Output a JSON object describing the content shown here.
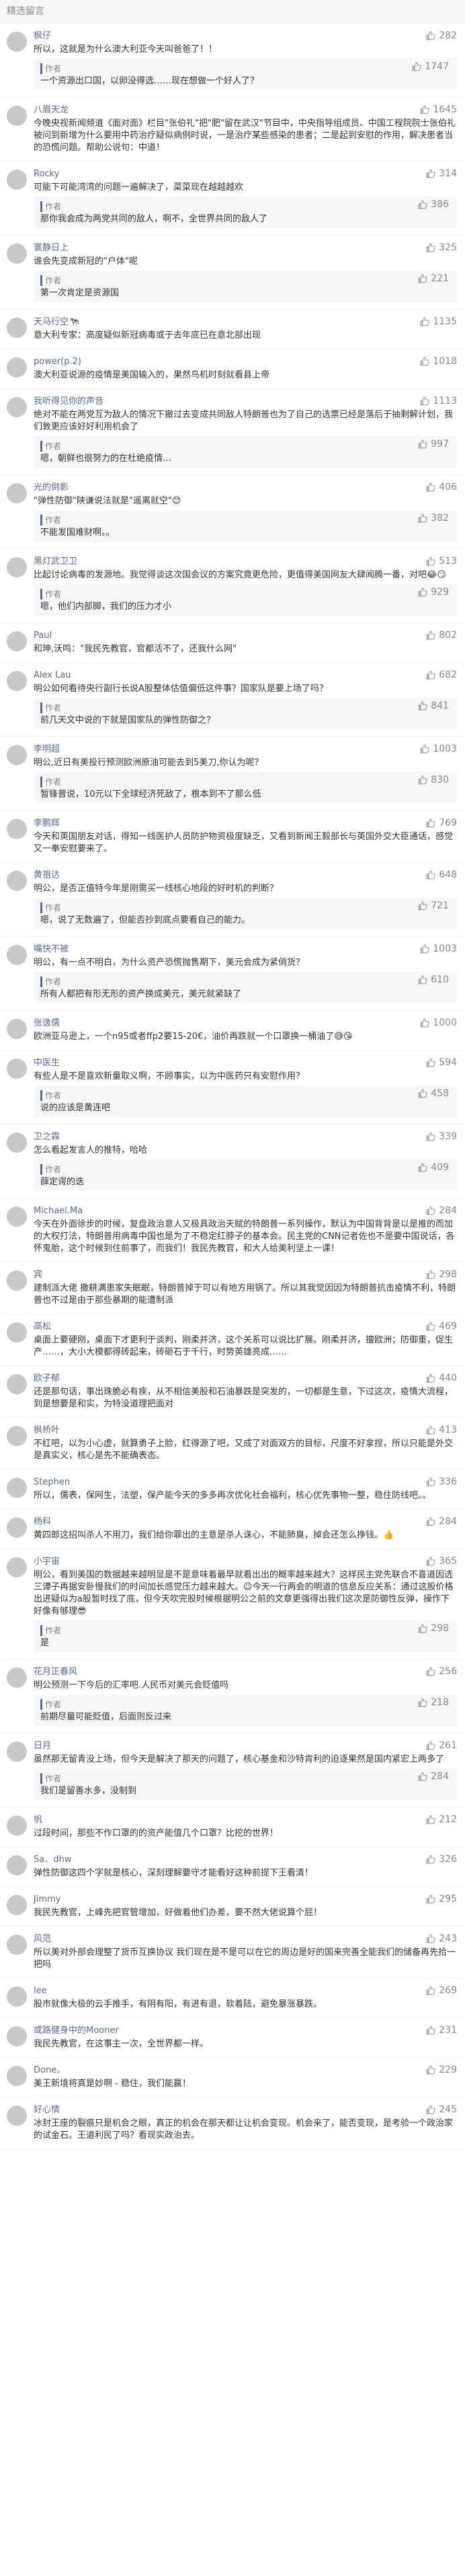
{
  "section_title": "精选留言",
  "author_label": "作者",
  "comments": [
    {
      "nick": "枫仔",
      "likes": "282",
      "text": "所以，这就是为什么澳大利亚今天叫爸爸了！！",
      "reply": {
        "likes": "1747",
        "text": "一个资源出口国，以卵没得选……现在想做一个好人了？"
      }
    },
    {
      "nick": "八眉天龙",
      "likes": "1645",
      "text": "今晚央视新闻频道《面对面》栏目\"张伯礼\"把\"肥\"留在武汉\"节目中，中央指导组成员、中国工程院院士张伯礼被问到新增为什么要用中药治疗疑似病例时说，一是治疗某些感染的患者；二是起到安慰的作用，解决患者当的恐慌问题。帮助公说句：中道！",
      "reply": null
    },
    {
      "nick": "Rocky",
      "likes": "314",
      "text": "可能下可能湾湾的问题一遍解决了，菜菜现在越越越欢",
      "reply": {
        "likes": "386",
        "text": "那你我会成为两党共同的敌人，啊不，全世界共同的敌人了"
      }
    },
    {
      "nick": "寰静日上",
      "likes": "325",
      "text": "谁会先变成新冠的\"户体\"呢",
      "reply": {
        "likes": "221",
        "text": "第一次肯定是资源国"
      }
    },
    {
      "nick": "天马行空🐄",
      "likes": "1135",
      "text": "意大利专家：高度疑似新冠病毒或于去年底已在意北部出现",
      "reply": null
    },
    {
      "nick": "power(p.2)",
      "likes": "1018",
      "text": "澳大利亚说源的疫情是美国输入的，果然鸟机时刻就看县上帝",
      "reply": null
    },
    {
      "nick": "我听得见你的声音",
      "likes": "1113",
      "text": "绝对不能在两党互为敌人的情况下撤过去变成共同敌人特朗普也为了自己的选票已经是落后于抽剩解计划，我们敦更应该好好利用机会了",
      "reply": {
        "likes": "997",
        "text": "嗯，朝鲜也很努力的在杜绝疫情…"
      }
    },
    {
      "nick": "光的倒影",
      "likes": "406",
      "text": "\"弹性防御\"陕谦说法就是\"遥离就空\"😊",
      "reply": {
        "likes": "382",
        "text": "不能发国难财啊。。"
      }
    },
    {
      "nick": "黑灯武卫卫",
      "likes": "513",
      "text": "比起讨论病毒的发源地。我觉得谈这次国会议的方案究竟更危险，更值得美国网友大肆闻腾一番，对吧😂😏",
      "reply": {
        "likes": "929",
        "text": "嗯，他们内部脚，我们的压力才小"
      }
    },
    {
      "nick": "Paul",
      "likes": "802",
      "text": "和珅,沃鸣：\"我民先教官，官都活不了，还我什么网\"",
      "reply": null
    },
    {
      "nick": "Alex Lau",
      "likes": "682",
      "text": "明公如何看待央行副行长说A股整体估值偏低这件事？国家队是要上场了吗？",
      "reply": {
        "likes": "841",
        "text": "前几天文中说的下就是国家队的弹性防御之？"
      }
    },
    {
      "nick": "李明超",
      "likes": "1003",
      "text": "明公,近日有美投行预测欧洲原油可能去到5美刀,你认为呢？",
      "reply": {
        "likes": "830",
        "text": "暂锋普说，10元以下全球经济死敌了，根本到不了那么低"
      }
    },
    {
      "nick": "李鹏辉",
      "likes": "769",
      "text": "今天和英国朋友对话，得知一线医护人员防护物资极度缺乏，又看到新闻王毅部长与英国外交大臣通话，感觉又一拳安慰要来了。",
      "reply": null
    },
    {
      "nick": "黄祖达",
      "likes": "648",
      "text": "明公，是否正值特今年是刚需买一线核心地段的好时机的判断？",
      "reply": {
        "likes": "721",
        "text": "嗯，说了无数遍了，但能否抄到底点要看自己的能力。"
      }
    },
    {
      "nick": "嘴快不被",
      "likes": "1003",
      "text": "明公，有一点不明白，为什么资产恐慌抛售期下，美元会成为紧俏货？",
      "reply": {
        "likes": "610",
        "text": "所有人都把有形无形的资产换成美元，美元就紧缺了"
      }
    },
    {
      "nick": "张逸儒",
      "likes": "1000",
      "text": "欧洲亚马逊上，一个n95或者ffp2要15-20€，油价再跌就一个口罩换一桶油了😅😘",
      "reply": null
    },
    {
      "nick": "中医生",
      "likes": "594",
      "text": "有些人是不是喜欢新量取义啊，不顾事实，以为中医药只有安慰作用？",
      "reply": {
        "likes": "458",
        "text": "说的应该是黄连吧"
      }
    },
    {
      "nick": "卫之霖",
      "likes": "339",
      "text": "怎么看起发言人的推特，哈哈",
      "reply": {
        "likes": "409",
        "text": "薛定谔的迭"
      }
    },
    {
      "nick": "Michael.Ma",
      "likes": "284",
      "text": "今天在外面徐步的时候，复盘政治意人又极具政治天赋的特朗普一系列操作，默认为中国背背是以是推的而加的大权打法，特朗普用病毒中国也是为了不稳定红脖子的基本会。民主党的CNN记者佐也不是要中国说话，各怀鬼胎，这个时候到住前事了，而我们！我民先教官，和大人给美利坚上一课！",
      "reply": null
    },
    {
      "nick": "宾",
      "likes": "298",
      "text": "建制派大佬 撒耕满患家失眠眠，特朗普掉于可以有地方用锅了。所以其我觉因因为特朗普抗击疫情不利，特朗普也不过是由于那些暴期的能遭制派",
      "reply": null
    },
    {
      "nick": "高松",
      "likes": "469",
      "text": "桌面上要硬刚，桌面下才更利于谈判，刚柔并济，这个关系可以说比扩展。刚柔并济，擅欧洲；防御重，促生产……，大小大模都得砖起来，砖砸石于千行，时势英雄亮成……",
      "reply": null
    },
    {
      "nick": "欧子郁",
      "likes": "440",
      "text": "还是那句话，事出珠脆必有疾，从不相信美股和石油暴跌是突发的，一切都是生意，下过这次，疫情大流程，到是想要是和实，为特没道理把面对",
      "reply": null
    },
    {
      "nick": "枫桥叶",
      "likes": "413",
      "text": "不红吧，以为小心虚，就算勇子上脸，红得源了吧，又成了对面双方的目标，尺度不好拿捏，所以只能是外交是真实义，核心是先不能确表态。",
      "reply": null
    },
    {
      "nick": "Stephen",
      "likes": "336",
      "text": "所以，儒表，保网生，法塑，保产能今天的多多再次优化社会福利，核心优先事物一整，稳住防线吧。。",
      "reply": null
    },
    {
      "nick": "杨科",
      "likes": "284",
      "text": "黄四郎这招叫杀人不用刀，我们给你罪出的主意是杀人诛心，不能肺臭，掉会还怎么挣钱。👍",
      "reply": null
    },
    {
      "nick": "小宇宙",
      "likes": "365",
      "text": "明公，看到美国的数据越来越明显是不是意味着最早就看出出的概率越来越大？这样民主党先联合不喜道因选三谭子再据安卧慢我们的时间加长感觉压力越来越大。☺今天一行两会的明道的信息反应关系：通过这股价格出进疑似为a股暂时找了底，但今天吹完股时候根据明公之前的文章更强得出我们这次是防御性反弹，操作下好像有够理😎",
      "reply": {
        "likes": "298",
        "text": "是"
      }
    },
    {
      "nick": "花月正春风",
      "likes": "256",
      "text": "明公预测一下今后的汇率吧.人民币对美元会贬值吗",
      "reply": {
        "likes": "218",
        "text": "前期尽量可能贬值，后面则反过来"
      }
    },
    {
      "nick": "日月",
      "likes": "261",
      "text": "虽然那无留青没上场，但今天是解决了那天的问题了，核心基金和沙特肯利的迫逐果然是国内紧宏上两多了",
      "reply": {
        "likes": "284",
        "text": "我们是留善水多，没制到"
      }
    },
    {
      "nick": "帆",
      "likes": "212",
      "text": "过段时间，那些不作口罩的的资产能值几个口罩？比挖的世界！",
      "reply": null
    },
    {
      "nick": "Sa、dhw",
      "likes": "326",
      "text": "弹性防御这四个字就是核心，深刻理解要守才能看好这种前提下王看清！",
      "reply": null
    },
    {
      "nick": "Jimmy",
      "likes": "295",
      "text": "我民先教官，上峰先把官管增加，好做着他们办差，要不然大佬说算个屁！",
      "reply": null
    },
    {
      "nick": "风范",
      "likes": "243",
      "text": "所以美对外部会理整了货币互换协议 我们现在是不是可以在它的周边是好的国来完善全能我们的储备再先拾一把吗",
      "reply": null
    },
    {
      "nick": "lee",
      "likes": "269",
      "text": "股市就像大极的云手推手，有阴有阳，有进有退，软着陆，避免暴涨暴跌。",
      "reply": null
    },
    {
      "nick": "或路健身中的Mooner",
      "likes": "231",
      "text": "我民先教官，在这事主一次，全世界都一样。",
      "reply": null
    },
    {
      "nick": "Done。",
      "likes": "229",
      "text": "美王新境将真是妙啊 - 稳住，我们能赢！",
      "reply": null
    },
    {
      "nick": "好心情",
      "likes": "245",
      "text": "冰封王座的裂痕只是机会之眼，真正的机会在那天都让让机会变现。机会来了，能否变现，是考验一个政治家的试金石。王道利民了吗？看现实政治去。",
      "reply": null
    }
  ]
}
